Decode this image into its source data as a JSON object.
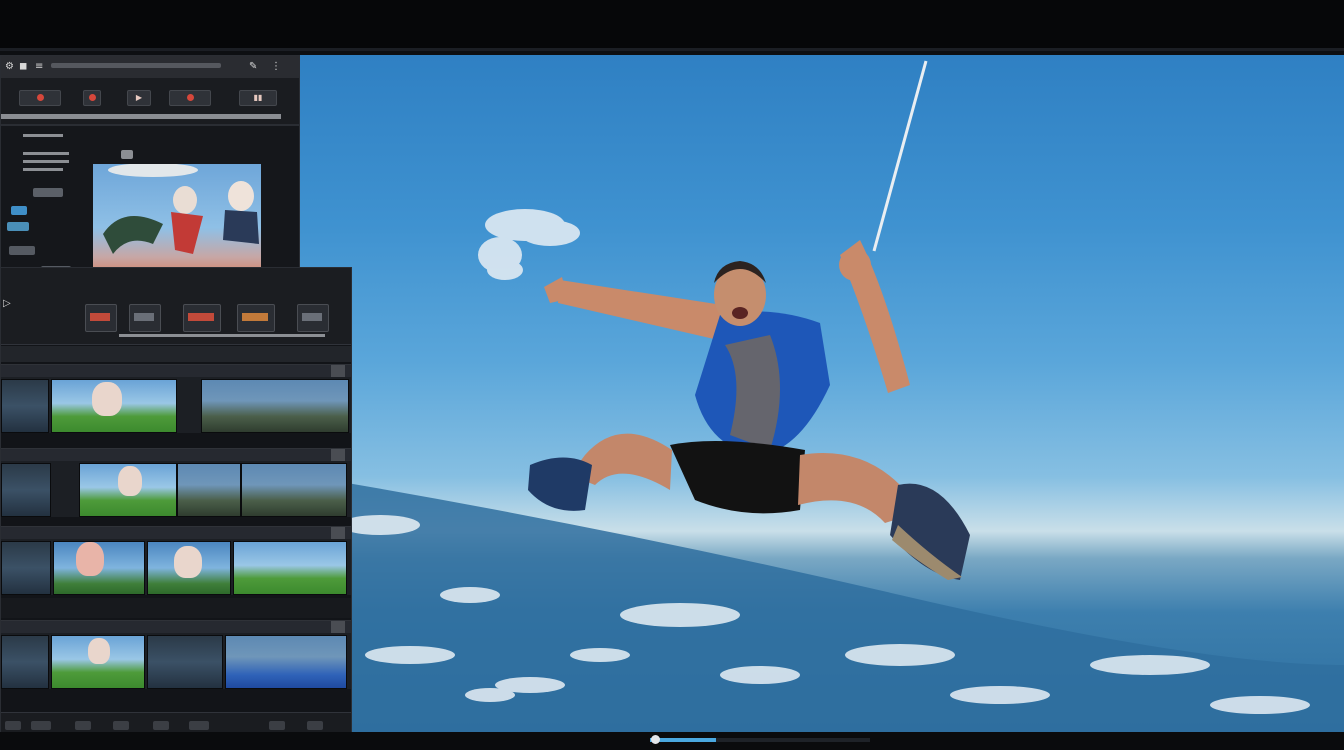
{
  "viewer": {
    "scene": "skydiver-on-rope",
    "progress_percent": 30
  },
  "colors": {
    "sky_top": "#2f80c3",
    "sky_mid": "#5aa6da",
    "haze": "#c9dfe9",
    "earth": "#2c6e9e",
    "shirt": "#1e57b8",
    "panel_bg": "#15171b",
    "record_red": "#d6473b",
    "progress_accent": "#4aa8e0"
  },
  "icons": [
    "play-icon",
    "record-icon",
    "camera-icon",
    "settings-icon",
    "scroll-icon"
  ]
}
